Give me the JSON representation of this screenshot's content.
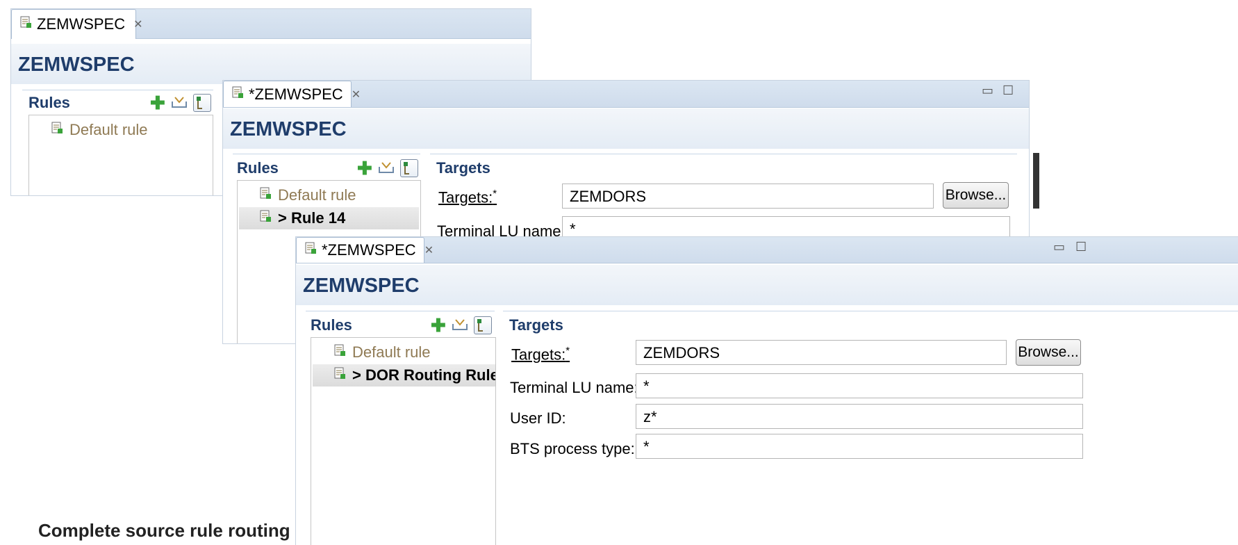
{
  "panels": [
    {
      "tab_title": "ZEMWSPEC",
      "editor_title": "ZEMWSPEC",
      "rules_title": "Rules",
      "tree": [
        {
          "label": "Default rule"
        }
      ]
    },
    {
      "tab_title": "*ZEMWSPEC",
      "editor_title": "ZEMWSPEC",
      "rules_title": "Rules",
      "targets_title": "Targets",
      "tree": [
        {
          "label": "Default rule"
        },
        {
          "label": "> Rule 14",
          "selected": true
        }
      ],
      "fields": [
        {
          "label": "Targets:",
          "required_mark": "*",
          "value": "ZEMDORS"
        },
        {
          "label": "Terminal LU name:",
          "value": "*"
        }
      ],
      "browse_label": "Browse..."
    },
    {
      "tab_title": "*ZEMWSPEC",
      "editor_title": "ZEMWSPEC",
      "rules_title": "Rules",
      "targets_title": "Targets",
      "tree": [
        {
          "label": "Default rule"
        },
        {
          "label": "> DOR Routing Rule",
          "selected": true
        }
      ],
      "fields": [
        {
          "label": "Targets:",
          "required_mark": "*",
          "value": "ZEMDORS"
        },
        {
          "label": "Terminal LU name:",
          "value": "*"
        },
        {
          "label": "User ID:",
          "value": "z*"
        },
        {
          "label": "BTS process type:",
          "value": "*"
        }
      ],
      "browse_label": "Browse..."
    }
  ],
  "icons": {
    "rule": "rule-icon",
    "add": "plus-icon",
    "import": "import-icon",
    "tree_toggle": "tree-view-icon",
    "close": "close-icon",
    "minimize": "minimize-icon",
    "maximize": "maximize-icon"
  },
  "window_controls": {
    "minimize": "▭",
    "maximize": "☐"
  },
  "colors": {
    "title": "#1f3d6b",
    "default_rule": "#8f7a54",
    "add_icon": "#3aa33a"
  },
  "background_text": "Complete source rule routing"
}
